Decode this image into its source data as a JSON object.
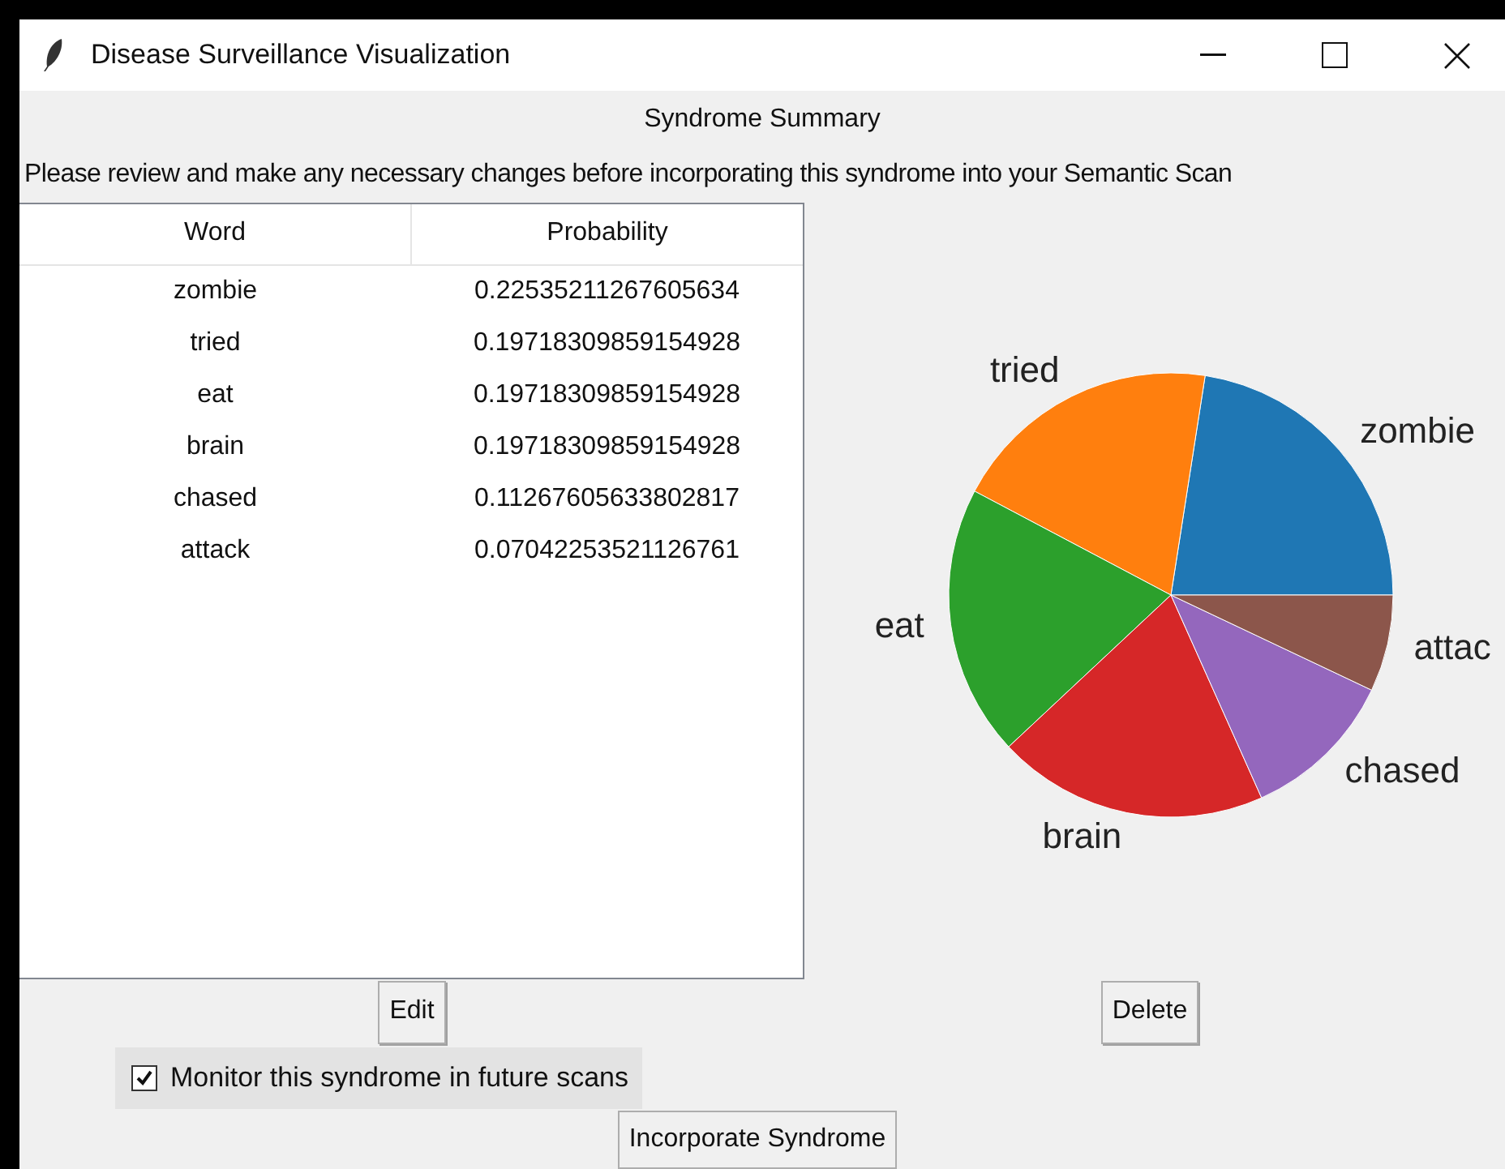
{
  "window": {
    "title": "Disease Surveillance Visualization"
  },
  "heading": "Syndrome Summary",
  "instructions": "Please review and make any necessary changes before incorporating this syndrome into your Semantic Scan",
  "table": {
    "columns": [
      "Word",
      "Probability"
    ],
    "rows": [
      [
        "zombie",
        "0.22535211267605634"
      ],
      [
        "tried",
        "0.19718309859154928"
      ],
      [
        "eat",
        "0.19718309859154928"
      ],
      [
        "brain",
        "0.19718309859154928"
      ],
      [
        "chased",
        "0.11267605633802817"
      ],
      [
        "attack",
        "0.07042253521126761"
      ]
    ]
  },
  "chart": {
    "chart_data": {
      "type": "pie",
      "categories": [
        "zombie",
        "tried",
        "eat",
        "brain",
        "chased",
        "attac"
      ],
      "values": [
        0.22535211267605634,
        0.19718309859154928,
        0.19718309859154928,
        0.19718309859154928,
        0.11267605633802817,
        0.07042253521126761
      ],
      "colors": [
        "#1f77b4",
        "#ff7f0e",
        "#2ca02c",
        "#d62728",
        "#9467bd",
        "#8c564b"
      ]
    }
  },
  "buttons": {
    "edit": "Edit",
    "delete": "Delete",
    "incorporate": "Incorporate Syndrome"
  },
  "monitor": {
    "label": "Monitor this syndrome in future scans",
    "checked": true
  }
}
